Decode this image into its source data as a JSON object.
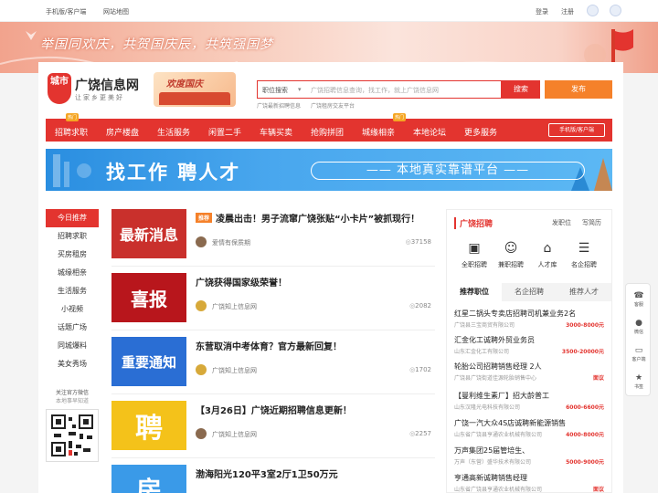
{
  "topbar": {
    "mobile": "手机版/客户端",
    "sitemap": "网站地图",
    "login": "登录",
    "register": "注册"
  },
  "banner": {
    "slogan": "举国同欢庆，共贺国庆辰，共筑强国梦"
  },
  "header": {
    "logo_badge": "城市",
    "logo_name": "广饶信息网",
    "logo_sub": "让家乡更美好",
    "fest_text": "欢度国庆",
    "search_select": "职位搜索",
    "search_placeholder": "广饶招聘信息查询，找工作，就上广饶信息网",
    "search_btn": "搜索",
    "publish_btn": "发布",
    "hot1": "广饶最新招聘信息",
    "hot2": "广饶租房交友平台"
  },
  "nav": {
    "items": [
      "招聘求职",
      "房产楼盘",
      "生活服务",
      "闲置二手",
      "车辆买卖",
      "抢购拼团",
      "城缘相亲",
      "本地论坛",
      "更多服务"
    ],
    "tag_hot": "热门",
    "tag_new": "热门",
    "app": "手机版/客户端"
  },
  "ad": {
    "headline": "找工作 聘人才",
    "pill": "—— 本地真实靠谱平台 ——"
  },
  "left_nav": {
    "items": [
      "今日推荐",
      "招聘求职",
      "买房租房",
      "城缘相亲",
      "生活服务",
      "小视频",
      "话题广场",
      "同城爆料",
      "美女秀场"
    ],
    "wx_title": "关注官方微信",
    "wx_sub": "本地事早知道"
  },
  "feed": [
    {
      "thumb": "最新消息",
      "tag": "推荐",
      "title": "凌晨出击！男子流窜广饶张贴“小卡片”被抓现行！",
      "author": "爱情有保质期",
      "views": "37158",
      "thumb_color": "#c9302c"
    },
    {
      "thumb": "喜报",
      "tag": "",
      "title": "广饶获得国家级荣誉！",
      "author": "广饶知上信息网",
      "views": "2082",
      "thumb_color": "#b8161c"
    },
    {
      "thumb": "重要通知",
      "tag": "",
      "title": "东营取消中考体育？官方最新回复！",
      "author": "广饶知上信息网",
      "views": "1702",
      "thumb_color": "#2a6ed4"
    },
    {
      "thumb": "聘",
      "tag": "",
      "title": "【3月26日】广饶近期招聘信息更新！",
      "author": "广饶知上信息网",
      "views": "2257",
      "thumb_color": "#f4c21a"
    },
    {
      "thumb": "房",
      "tag": "",
      "title": "渤海阳光120平3室2厅1卫50万元",
      "author": "",
      "views": "",
      "thumb_color": "#3a9ae8"
    }
  ],
  "right_panel": {
    "title": "广饶招聘",
    "post": "发职位",
    "resume": "写简历",
    "cats": [
      {
        "icon": "briefcase-icon",
        "glyph": "▣",
        "label": "全职招聘"
      },
      {
        "icon": "person-icon",
        "glyph": "☺",
        "label": "兼职招聘"
      },
      {
        "icon": "graduation-icon",
        "glyph": "⌂",
        "label": "人才库"
      },
      {
        "icon": "document-icon",
        "glyph": "☰",
        "label": "名企招聘"
      }
    ],
    "tabs": [
      "推荐职位",
      "名企招聘",
      "推荐人才"
    ],
    "jobs": [
      {
        "title": "红星二锅头专卖店招聘司机兼业务2名",
        "company": "广饶县三宝商贸有限公司",
        "salary": "3000-8000元"
      },
      {
        "title": "汇金化工诚聘外贸业务员",
        "company": "山东汇金化工有限公司",
        "salary": "3500-20000元"
      },
      {
        "title": "轮胎公司招聘销售经理 2人",
        "company": "广饶县广饶街道佳源轮胎销售中心",
        "salary": "面议"
      },
      {
        "title": "【曼利维生素厂】招大龄普工",
        "company": "山东汉隆光电科技有限公司",
        "salary": "6000-6600元"
      },
      {
        "title": "广饶一汽大众4S店诚聘新能源销售",
        "company": "山东省广饶县亨通农业机械有限公司",
        "salary": "4000-8000元"
      },
      {
        "title": "万声集团25届管培生、",
        "company": "万声（东营）盛华技术有限公司",
        "salary": "5000-9000元"
      },
      {
        "title": "亨通高新诚聘销售经理",
        "company": "山东省广饶县亨通农业机械有限公司",
        "salary": "面议"
      }
    ]
  },
  "float_bar": [
    "客服",
    "微信",
    "客户端",
    "书签"
  ],
  "colors": {
    "brand": "#e3342f",
    "orange": "#f5812a"
  }
}
